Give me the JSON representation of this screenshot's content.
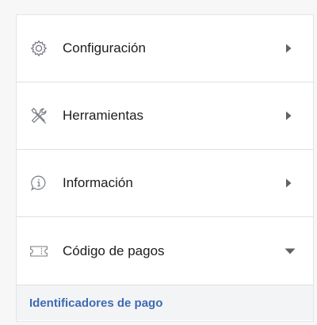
{
  "menu": {
    "items": [
      {
        "label": "Configuración",
        "icon": "gear-icon",
        "indicator": "chevron-right-icon"
      },
      {
        "label": "Herramientas",
        "icon": "tools-icon",
        "indicator": "chevron-right-icon"
      },
      {
        "label": "Información",
        "icon": "info-icon",
        "indicator": "chevron-right-icon"
      },
      {
        "label": "Código de pagos",
        "icon": "ticket-icon",
        "indicator": "chevron-down-icon"
      }
    ],
    "submenu": {
      "link": "Identificadores de pago"
    }
  },
  "colors": {
    "icon_stroke": "#777b80",
    "chevron": "#5e6268",
    "link": "#3d6ab3",
    "text": "#1d1d1f",
    "divider": "#dfe0e2",
    "submenu_bg": "#f3f4f6"
  }
}
